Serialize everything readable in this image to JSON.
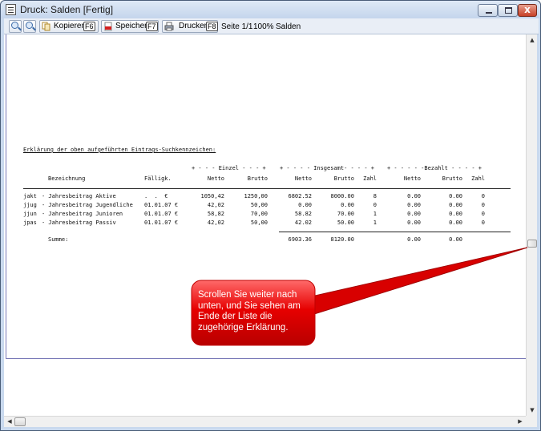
{
  "window": {
    "title": "Druck: Salden [Fertig]",
    "close_glyph": "x"
  },
  "toolbar": {
    "zoom_in_icon": "zoom-in-icon",
    "zoom_out_icon": "zoom-out-icon",
    "copy": {
      "label": "Kopieren",
      "key": "F6"
    },
    "save": {
      "label": "Speichern",
      "key": "F7"
    },
    "print": {
      "label": "Drucken",
      "key": "F8"
    },
    "page_info": "Seite 1/1",
    "zoom": "100%",
    "report": "Salden"
  },
  "report": {
    "legend_heading": "Erklärung der oben aufgeführten Eintrags-Suchkennzeichen:",
    "group_headers": {
      "single": "+ - - - Einzel - - - +",
      "total": "+ - - - - Insgesamt- - - - +",
      "paid": "+ - - - - -Bezahlt - - - - +"
    },
    "column_headers": {
      "description": "Bezeichnung",
      "due": "Fälligk.",
      "single_net": "Netto",
      "single_gross": "Brutto",
      "total_net": "Netto",
      "total_gross": "Brutto",
      "total_count": "Zahl",
      "paid_net": "Netto",
      "paid_gross": "Brutto",
      "paid_count": "Zahl"
    },
    "rows": [
      {
        "code": "jakt",
        "description": "- Jahresbeitrag Aktive",
        "due": ".  .  €",
        "single_net": "1050,42",
        "single_gross": "1250,00",
        "total_net": "6802.52",
        "total_gross": "8000.00",
        "total_count": "8",
        "paid_net": "0.00",
        "paid_gross": "0.00",
        "paid_count": "0"
      },
      {
        "code": "jjug",
        "description": "- Jahresbeitrag Jugendliche",
        "due": "01.01.07 €",
        "single_net": "42,02",
        "single_gross": "50,00",
        "total_net": "0.00",
        "total_gross": "0.00",
        "total_count": "0",
        "paid_net": "0.00",
        "paid_gross": "0.00",
        "paid_count": "0"
      },
      {
        "code": "jjun",
        "description": "- Jahresbeitrag Junioren",
        "due": "01.01.07 €",
        "single_net": "58,82",
        "single_gross": "70,00",
        "total_net": "58.82",
        "total_gross": "70.00",
        "total_count": "1",
        "paid_net": "0.00",
        "paid_gross": "0.00",
        "paid_count": "0"
      },
      {
        "code": "jpas",
        "description": "- Jahresbeitrag Passiv",
        "due": "01.01.07 €",
        "single_net": "42,02",
        "single_gross": "50,00",
        "total_net": "42.02",
        "total_gross": "50.00",
        "total_count": "1",
        "paid_net": "0.00",
        "paid_gross": "0.00",
        "paid_count": "0"
      }
    ],
    "sum": {
      "label": "Summe:",
      "total_net": "6903.36",
      "total_gross": "8120.00",
      "paid_net": "0.00",
      "paid_gross": "0.00"
    }
  },
  "callout": {
    "text": "Scrollen Sie weiter nach unten, und Sie sehen am Ende der Liste die zugehörige Erklärung.",
    "color": "#e60000"
  },
  "scrollbars": {
    "up": "▲",
    "down": "▼",
    "left": "◀",
    "right": "▶"
  }
}
